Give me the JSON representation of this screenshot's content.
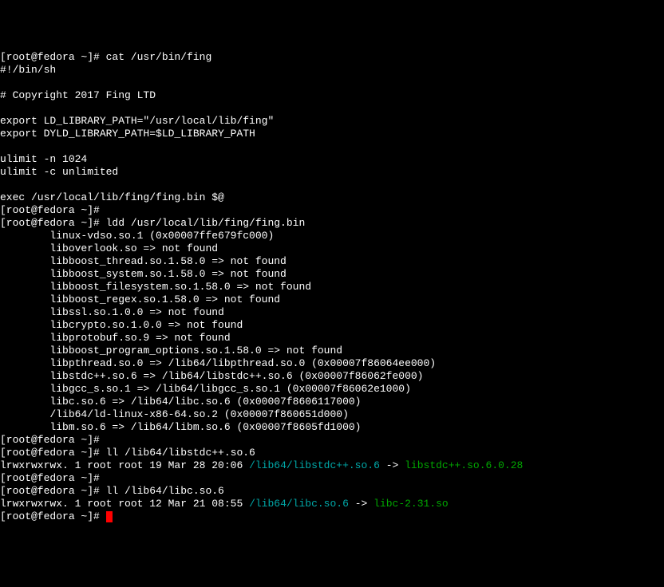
{
  "lines": [
    {
      "segments": [
        {
          "text": "[root@fedora ~]# cat /usr/bin/fing",
          "class": "white"
        }
      ]
    },
    {
      "segments": [
        {
          "text": "#!/bin/sh",
          "class": "white"
        }
      ]
    },
    {
      "segments": [
        {
          "text": "",
          "class": "white"
        }
      ]
    },
    {
      "segments": [
        {
          "text": "# Copyright 2017 Fing LTD",
          "class": "white"
        }
      ]
    },
    {
      "segments": [
        {
          "text": "",
          "class": "white"
        }
      ]
    },
    {
      "segments": [
        {
          "text": "export LD_LIBRARY_PATH=\"/usr/local/lib/fing\"",
          "class": "white"
        }
      ]
    },
    {
      "segments": [
        {
          "text": "export DYLD_LIBRARY_PATH=$LD_LIBRARY_PATH",
          "class": "white"
        }
      ]
    },
    {
      "segments": [
        {
          "text": "",
          "class": "white"
        }
      ]
    },
    {
      "segments": [
        {
          "text": "ulimit -n 1024",
          "class": "white"
        }
      ]
    },
    {
      "segments": [
        {
          "text": "ulimit -c unlimited",
          "class": "white"
        }
      ]
    },
    {
      "segments": [
        {
          "text": "",
          "class": "white"
        }
      ]
    },
    {
      "segments": [
        {
          "text": "exec /usr/local/lib/fing/fing.bin $@",
          "class": "white"
        }
      ]
    },
    {
      "segments": [
        {
          "text": "[root@fedora ~]#",
          "class": "white"
        }
      ]
    },
    {
      "segments": [
        {
          "text": "[root@fedora ~]# ldd /usr/local/lib/fing/fing.bin",
          "class": "white"
        }
      ]
    },
    {
      "segments": [
        {
          "text": "        linux-vdso.so.1 (0x00007ffe679fc000)",
          "class": "white"
        }
      ]
    },
    {
      "segments": [
        {
          "text": "        liboverlook.so => not found",
          "class": "white"
        }
      ]
    },
    {
      "segments": [
        {
          "text": "        libboost_thread.so.1.58.0 => not found",
          "class": "white"
        }
      ]
    },
    {
      "segments": [
        {
          "text": "        libboost_system.so.1.58.0 => not found",
          "class": "white"
        }
      ]
    },
    {
      "segments": [
        {
          "text": "        libboost_filesystem.so.1.58.0 => not found",
          "class": "white"
        }
      ]
    },
    {
      "segments": [
        {
          "text": "        libboost_regex.so.1.58.0 => not found",
          "class": "white"
        }
      ]
    },
    {
      "segments": [
        {
          "text": "        libssl.so.1.0.0 => not found",
          "class": "white"
        }
      ]
    },
    {
      "segments": [
        {
          "text": "        libcrypto.so.1.0.0 => not found",
          "class": "white"
        }
      ]
    },
    {
      "segments": [
        {
          "text": "        libprotobuf.so.9 => not found",
          "class": "white"
        }
      ]
    },
    {
      "segments": [
        {
          "text": "        libboost_program_options.so.1.58.0 => not found",
          "class": "white"
        }
      ]
    },
    {
      "segments": [
        {
          "text": "        libpthread.so.0 => /lib64/libpthread.so.0 (0x00007f86064ee000)",
          "class": "white"
        }
      ]
    },
    {
      "segments": [
        {
          "text": "        libstdc++.so.6 => /lib64/libstdc++.so.6 (0x00007f86062fe000)",
          "class": "white"
        }
      ]
    },
    {
      "segments": [
        {
          "text": "        libgcc_s.so.1 => /lib64/libgcc_s.so.1 (0x00007f86062e1000)",
          "class": "white"
        }
      ]
    },
    {
      "segments": [
        {
          "text": "        libc.so.6 => /lib64/libc.so.6 (0x00007f8606117000)",
          "class": "white"
        }
      ]
    },
    {
      "segments": [
        {
          "text": "        /lib64/ld-linux-x86-64.so.2 (0x00007f860651d000)",
          "class": "white"
        }
      ]
    },
    {
      "segments": [
        {
          "text": "        libm.so.6 => /lib64/libm.so.6 (0x00007f8605fd1000)",
          "class": "white"
        }
      ]
    },
    {
      "segments": [
        {
          "text": "[root@fedora ~]#",
          "class": "white"
        }
      ]
    },
    {
      "segments": [
        {
          "text": "[root@fedora ~]# ll /lib64/libstdc++.so.6",
          "class": "white"
        }
      ]
    },
    {
      "segments": [
        {
          "text": "lrwxrwxrwx. 1 root root 19 Mar 28 20:06 ",
          "class": "white"
        },
        {
          "text": "/lib64/libstdc++.so.6",
          "class": "cyan"
        },
        {
          "text": " -> ",
          "class": "white"
        },
        {
          "text": "libstdc++.so.6.0.28",
          "class": "green"
        }
      ]
    },
    {
      "segments": [
        {
          "text": "[root@fedora ~]#",
          "class": "white"
        }
      ]
    },
    {
      "segments": [
        {
          "text": "[root@fedora ~]# ll /lib64/libc.so.6",
          "class": "white"
        }
      ]
    },
    {
      "segments": [
        {
          "text": "lrwxrwxrwx. 1 root root 12 Mar 21 08:55 ",
          "class": "white"
        },
        {
          "text": "/lib64/libc.so.6",
          "class": "cyan"
        },
        {
          "text": " -> ",
          "class": "white"
        },
        {
          "text": "libc-2.31.so",
          "class": "green"
        }
      ]
    },
    {
      "segments": [
        {
          "text": "[root@fedora ~]# ",
          "class": "white"
        }
      ],
      "cursor": true
    }
  ]
}
